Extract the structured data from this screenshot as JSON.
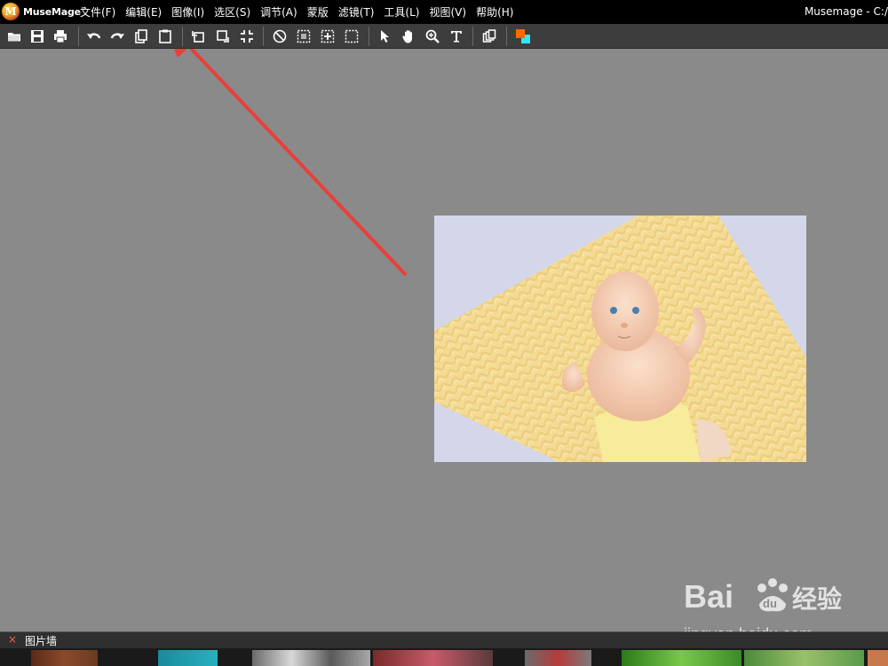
{
  "app": {
    "logo_text": "MuseMage",
    "logo_tm": "™",
    "title": "Musemage - C:/"
  },
  "menu": [
    {
      "label": "文件(F)"
    },
    {
      "label": "编辑(E)"
    },
    {
      "label": "图像(I)"
    },
    {
      "label": "选区(S)"
    },
    {
      "label": "调节(A)"
    },
    {
      "label": "蒙版"
    },
    {
      "label": "滤镜(T)"
    },
    {
      "label": "工具(L)"
    },
    {
      "label": "视图(V)"
    },
    {
      "label": "帮助(H)"
    }
  ],
  "toolbar": {
    "buttons": [
      {
        "icon": "open-folder-icon"
      },
      {
        "icon": "save-icon"
      },
      {
        "icon": "print-icon"
      },
      {
        "icon": "undo-icon"
      },
      {
        "icon": "redo-icon"
      },
      {
        "icon": "copy-icon"
      },
      {
        "icon": "paste-icon"
      },
      {
        "icon": "rotate-left-icon"
      },
      {
        "icon": "rotate-right-icon"
      },
      {
        "icon": "crop-icon"
      },
      {
        "icon": "deselect-icon"
      },
      {
        "icon": "marquee-select-icon"
      },
      {
        "icon": "magic-select-icon"
      },
      {
        "icon": "rect-select-icon"
      },
      {
        "icon": "pointer-icon"
      },
      {
        "icon": "hand-icon"
      },
      {
        "icon": "zoom-icon"
      },
      {
        "icon": "text-icon"
      },
      {
        "icon": "layers-icon"
      },
      {
        "icon": "color-swatch-icon"
      }
    ],
    "foreground_color": "#ff6a00",
    "background_color": "#33e5f0"
  },
  "workspace": {
    "background": "#8a8a8a",
    "annotation_color": "#e8403a"
  },
  "filmstrip": {
    "close_glyph": "×",
    "title": "图片墙"
  },
  "watermark": {
    "brand_text": "Bai",
    "brand_du": "du",
    "brand_cn": "经验",
    "url": "jingyan.baidu.com"
  }
}
